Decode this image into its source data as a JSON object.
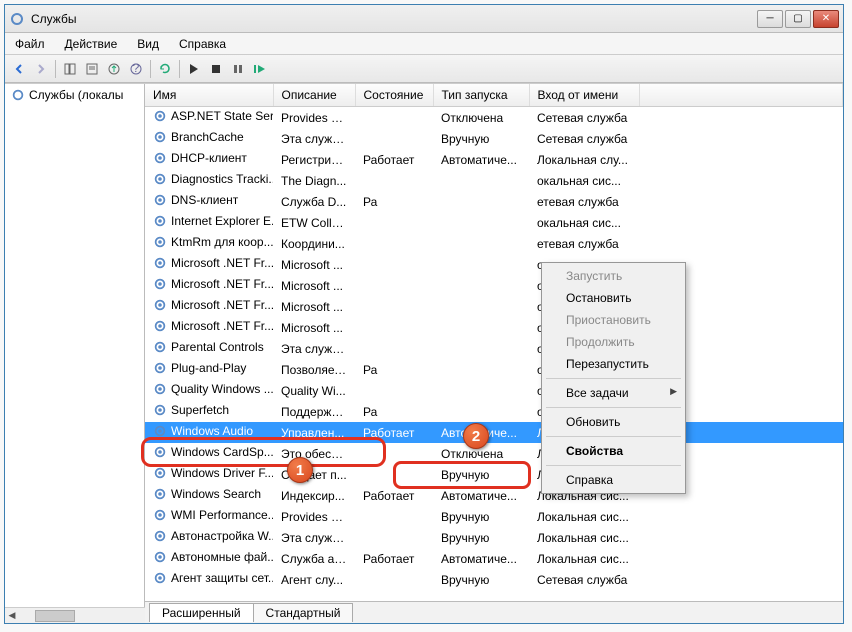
{
  "window": {
    "title": "Службы"
  },
  "menu": [
    "Файл",
    "Действие",
    "Вид",
    "Справка"
  ],
  "sidebar": {
    "label": "Службы (локалы"
  },
  "columns": [
    "Имя",
    "Описание",
    "Состояние",
    "Тип запуска",
    "Вход от имени"
  ],
  "context_menu": [
    {
      "label": "Запустить",
      "disabled": true
    },
    {
      "label": "Остановить",
      "disabled": false
    },
    {
      "label": "Приостановить",
      "disabled": true
    },
    {
      "label": "Продолжить",
      "disabled": true
    },
    {
      "label": "Перезапустить",
      "disabled": false
    },
    {
      "sep": true
    },
    {
      "label": "Все задачи",
      "submenu": true
    },
    {
      "sep": true
    },
    {
      "label": "Обновить"
    },
    {
      "sep": true
    },
    {
      "label": "Свойства",
      "bold": true
    },
    {
      "sep": true
    },
    {
      "label": "Справка"
    }
  ],
  "services": [
    {
      "name": "ASP.NET State Ser...",
      "desc": "Provides s...",
      "state": "",
      "start": "Отключена",
      "logon": "Сетевая служба"
    },
    {
      "name": "BranchCache",
      "desc": "Эта служб...",
      "state": "",
      "start": "Вручную",
      "logon": "Сетевая служба"
    },
    {
      "name": "DHCP-клиент",
      "desc": "Регистрир...",
      "state": "Работает",
      "start": "Автоматиче...",
      "logon": "Локальная слу..."
    },
    {
      "name": "Diagnostics Tracki...",
      "desc": "The Diagn...",
      "state": "",
      "start": "",
      "logon": "окальная сис..."
    },
    {
      "name": "DNS-клиент",
      "desc": "Служба D...",
      "state": "Ра",
      "start": "",
      "logon": "етевая служба"
    },
    {
      "name": "Internet Explorer E...",
      "desc": "ETW Colle...",
      "state": "",
      "start": "",
      "logon": "окальная сис..."
    },
    {
      "name": "KtmRm для коор...",
      "desc": "Координи...",
      "state": "",
      "start": "",
      "logon": "етевая служба"
    },
    {
      "name": "Microsoft .NET Fr...",
      "desc": "Microsoft ...",
      "state": "",
      "start": "",
      "logon": "окальная сис..."
    },
    {
      "name": "Microsoft .NET Fr...",
      "desc": "Microsoft ...",
      "state": "",
      "start": "",
      "logon": "окальная сис..."
    },
    {
      "name": "Microsoft .NET Fr...",
      "desc": "Microsoft ...",
      "state": "",
      "start": "",
      "logon": "окальная сис..."
    },
    {
      "name": "Microsoft .NET Fr...",
      "desc": "Microsoft ...",
      "state": "",
      "start": "",
      "logon": "окальная сис..."
    },
    {
      "name": "Parental Controls",
      "desc": "Эта служб...",
      "state": "",
      "start": "",
      "logon": "окальная слу..."
    },
    {
      "name": "Plug-and-Play",
      "desc": "Позволяет...",
      "state": "Ра",
      "start": "",
      "logon": "окальная сис..."
    },
    {
      "name": "Quality Windows ...",
      "desc": "Quality Wi...",
      "state": "",
      "start": "",
      "logon": "окальная слу..."
    },
    {
      "name": "Superfetch",
      "desc": "Поддержи...",
      "state": "Ра",
      "start": "",
      "logon": "окальная сис..."
    },
    {
      "name": "Windows Audio",
      "desc": "Управлен...",
      "state": "Работает",
      "start": "Автоматиче...",
      "logon": "Локальная слу...",
      "selected": true
    },
    {
      "name": "Windows CardSp...",
      "desc": "Это обесп...",
      "state": "",
      "start": "Отключена",
      "logon": "Локальная сис..."
    },
    {
      "name": "Windows Driver F...",
      "desc": "Создает п...",
      "state": "",
      "start": "Вручную",
      "logon": "Локальная сис..."
    },
    {
      "name": "Windows Search",
      "desc": "Индексир...",
      "state": "Работает",
      "start": "Автоматиче...",
      "logon": "Локальная сис..."
    },
    {
      "name": "WMI Performance...",
      "desc": "Provides p...",
      "state": "",
      "start": "Вручную",
      "logon": "Локальная сис..."
    },
    {
      "name": "Автонастройка W...",
      "desc": "Эта служб...",
      "state": "",
      "start": "Вручную",
      "logon": "Локальная сис..."
    },
    {
      "name": "Автономные фай...",
      "desc": "Служба ав...",
      "state": "Работает",
      "start": "Автоматиче...",
      "logon": "Локальная сис..."
    },
    {
      "name": "Агент защиты сет...",
      "desc": "Агент слу...",
      "state": "",
      "start": "Вручную",
      "logon": "Сетевая служба"
    }
  ],
  "tabs": [
    "Расширенный",
    "Стандартный"
  ],
  "badges": {
    "one": "1",
    "two": "2"
  }
}
